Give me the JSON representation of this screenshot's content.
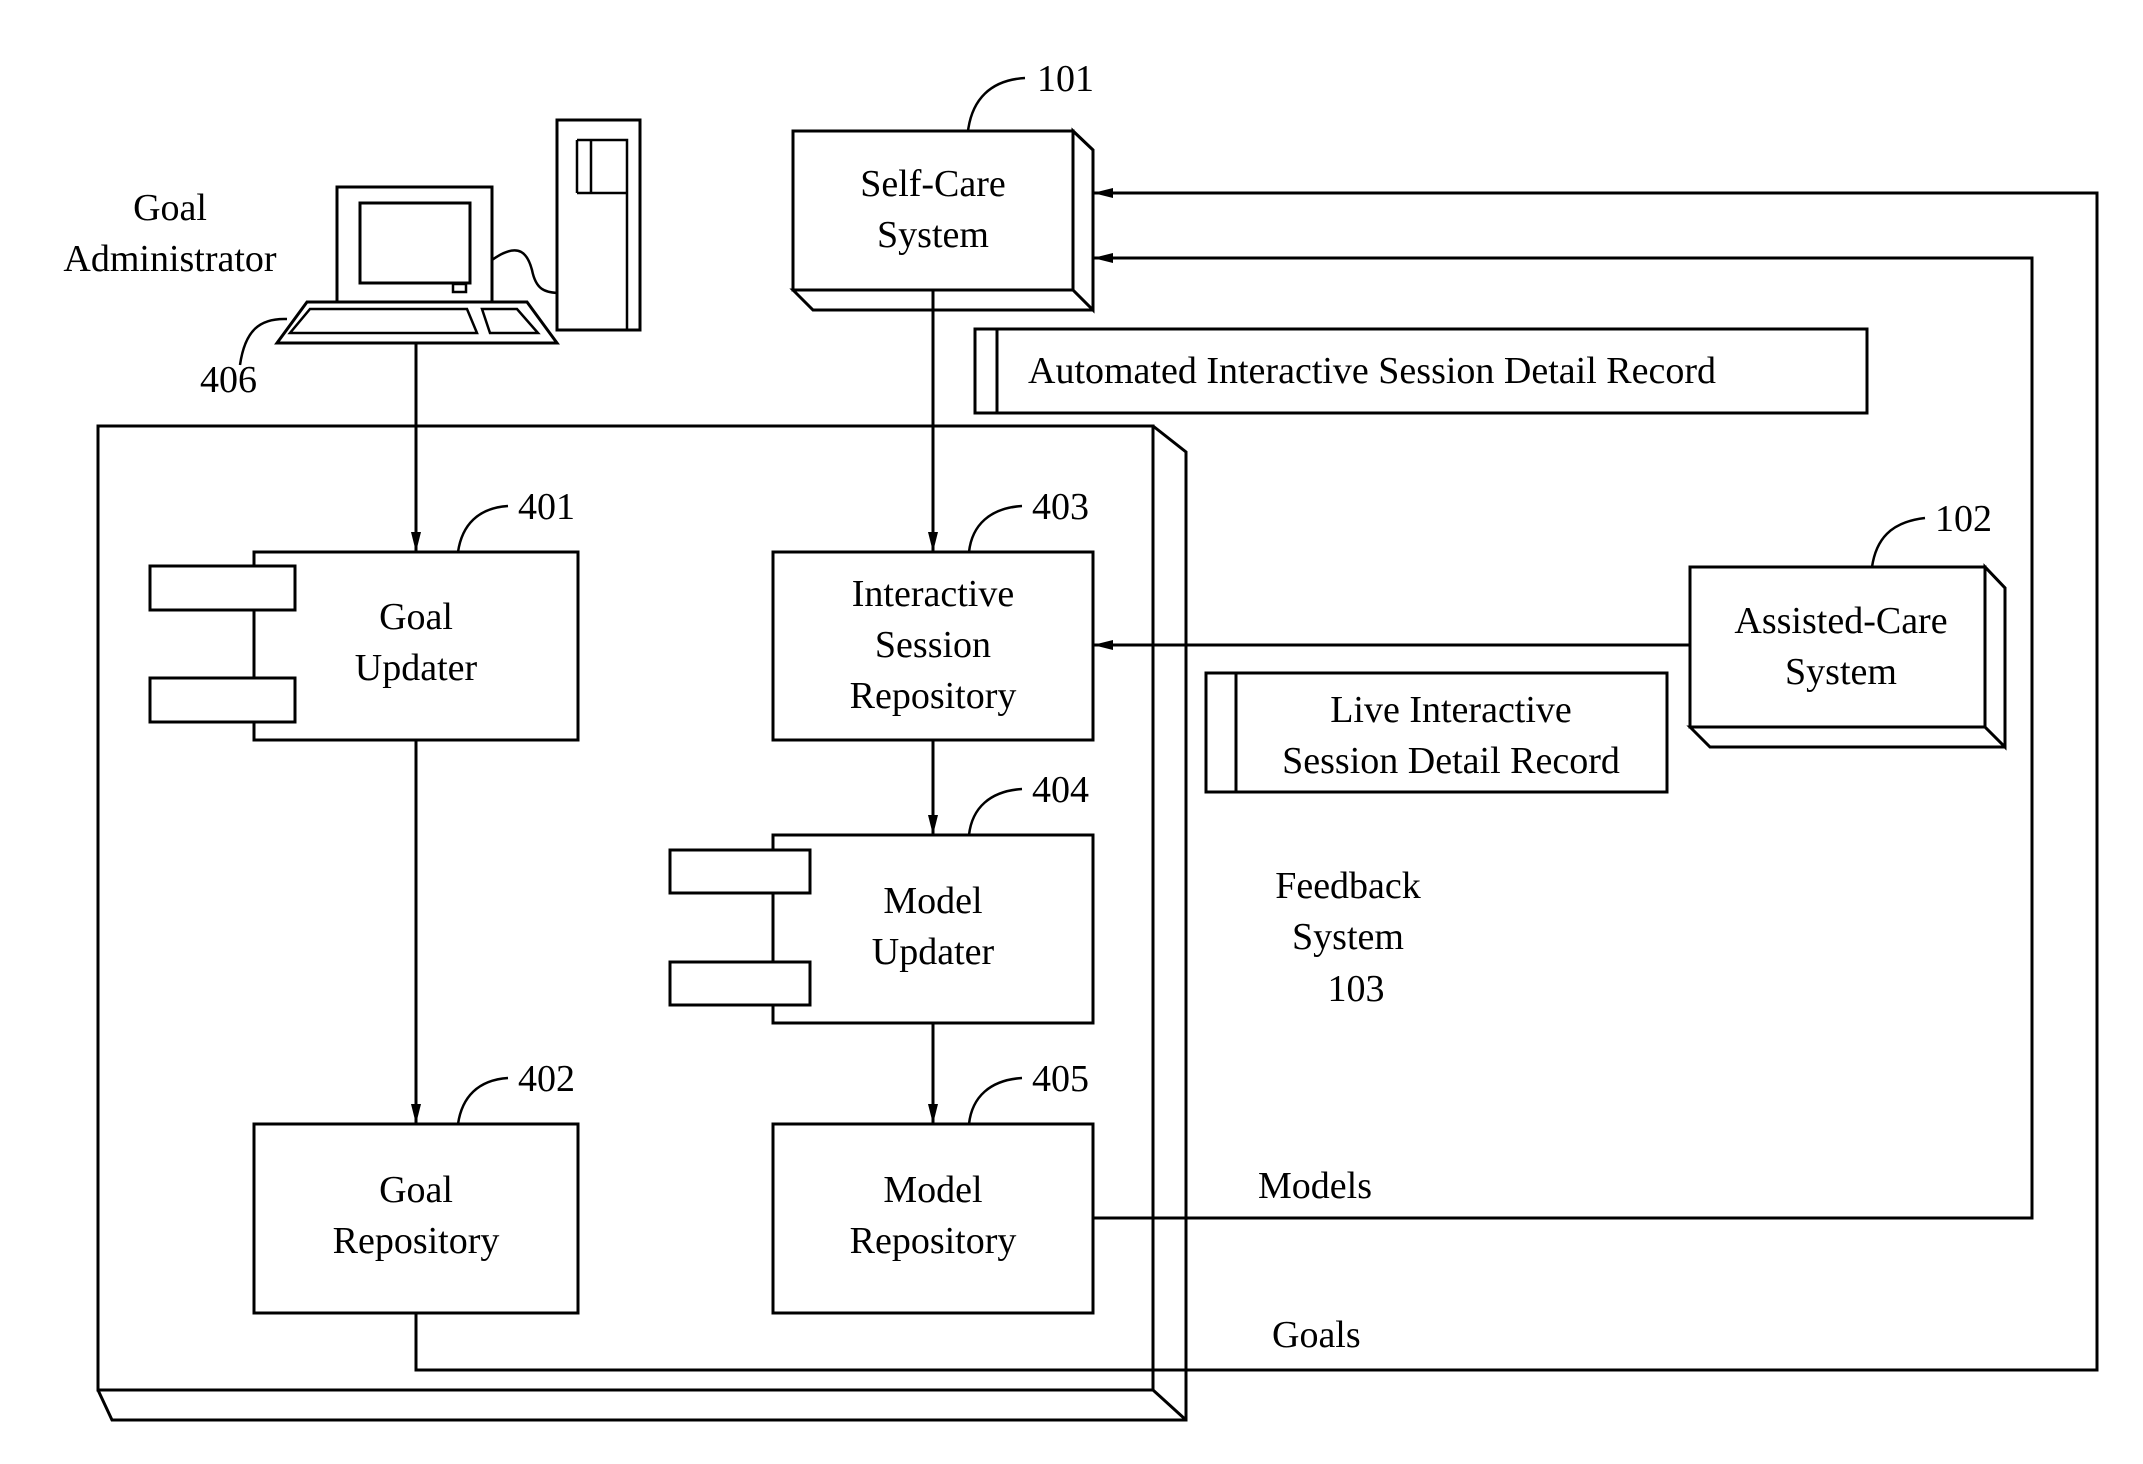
{
  "figure": {
    "nodes": {
      "self_care": {
        "ref": "101",
        "lines": [
          "Self-Care",
          "System"
        ]
      },
      "assisted_care": {
        "ref": "102",
        "lines": [
          "Assisted-Care",
          "System"
        ]
      },
      "feedback_system": {
        "lines": [
          "Feedback",
          "System",
          "103"
        ]
      },
      "goal_updater": {
        "ref": "401",
        "lines": [
          "Goal",
          "Updater"
        ]
      },
      "goal_repository": {
        "ref": "402",
        "lines": [
          "Goal",
          "Repository"
        ]
      },
      "interactive_session_repository": {
        "ref": "403",
        "lines": [
          "Interactive",
          "Session",
          "Repository"
        ]
      },
      "model_updater": {
        "ref": "404",
        "lines": [
          "Model",
          "Updater"
        ]
      },
      "model_repository": {
        "ref": "405",
        "lines": [
          "Model",
          "Repository"
        ]
      },
      "goal_administrator": {
        "ref": "406",
        "lines": [
          "Goal",
          "Administrator"
        ]
      }
    },
    "records": {
      "automated": "Automated Interactive Session Detail Record",
      "live": [
        "Live Interactive",
        "Session Detail Record"
      ]
    },
    "edge_labels": {
      "models": "Models",
      "goals": "Goals"
    },
    "edges": [
      {
        "from": "goal_administrator",
        "to": "goal_updater"
      },
      {
        "from": "goal_updater",
        "to": "goal_repository"
      },
      {
        "from": "self_care",
        "to": "interactive_session_repository"
      },
      {
        "from": "assisted_care",
        "to": "interactive_session_repository"
      },
      {
        "from": "interactive_session_repository",
        "to": "model_updater"
      },
      {
        "from": "model_updater",
        "to": "model_repository"
      },
      {
        "from": "model_repository",
        "to": "self_care",
        "label": "Models"
      },
      {
        "from": "goal_repository",
        "to": "self_care",
        "label": "Goals"
      }
    ]
  }
}
